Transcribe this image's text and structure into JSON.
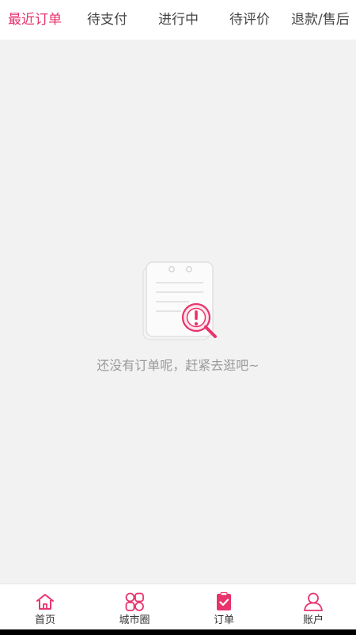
{
  "colors": {
    "accent": "#e8336d",
    "background": "#f2f2f2",
    "text_muted": "#9a9a9a"
  },
  "tabs": [
    {
      "label": "最近订单",
      "active": true
    },
    {
      "label": "待支付",
      "active": false
    },
    {
      "label": "进行中",
      "active": false
    },
    {
      "label": "待评价",
      "active": false
    },
    {
      "label": "退款/售后",
      "active": false
    }
  ],
  "empty_state": {
    "icon": "order-search-alert-icon",
    "message": "还没有订单呢，赶紧去逛吧~"
  },
  "bottom_nav": [
    {
      "label": "首页",
      "icon": "home-icon"
    },
    {
      "label": "城市圈",
      "icon": "city-circle-icon"
    },
    {
      "label": "订单",
      "icon": "order-clipboard-icon",
      "active": true
    },
    {
      "label": "账户",
      "icon": "user-icon"
    }
  ]
}
